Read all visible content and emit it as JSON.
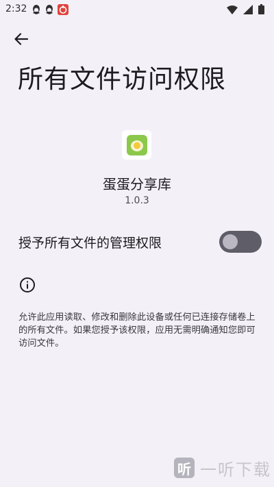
{
  "status_bar": {
    "time": "2:32",
    "left_icons": [
      "qq-icon",
      "qq-icon",
      "app-notification-icon"
    ],
    "right_icons": [
      "wifi-icon",
      "signal-icon",
      "battery-icon"
    ]
  },
  "header": {
    "title": "所有文件访问权限"
  },
  "app": {
    "name": "蛋蛋分享库",
    "version": "1.0.3"
  },
  "permission": {
    "label": "授予所有文件的管理权限",
    "enabled": false
  },
  "info": {
    "description": "允许此应用读取、修改和删除此设备或任何已连接存储卷上的所有文件。如果您授予该权限，应用无需明确通知您即可访问文件。"
  },
  "watermark": {
    "mark": "听",
    "text": "一听下载"
  },
  "colors": {
    "background": "#f3f1f7",
    "toggle_track": "#5f5d67",
    "toggle_thumb": "#bab7c2",
    "app_icon_green": "#8cc84b",
    "app_icon_yellow": "#f5e27a"
  }
}
